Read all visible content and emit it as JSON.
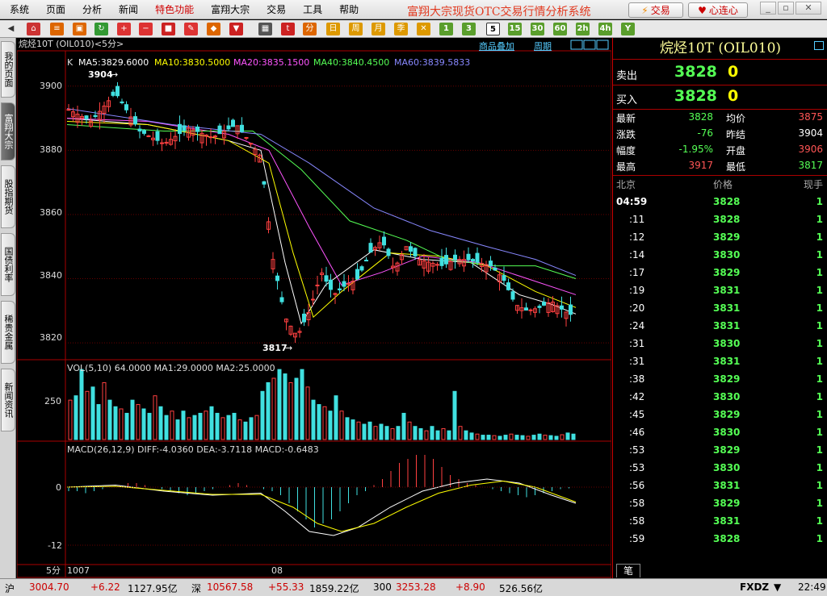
{
  "menu": {
    "items": [
      "系统",
      "页面",
      "分析",
      "新闻",
      "特色功能",
      "富翔大宗",
      "交易",
      "工具",
      "帮助"
    ],
    "app_title": "富翔大宗现货OTC交易行情分析系统",
    "trade_button": "交易",
    "connect_button": "心连心"
  },
  "toolbar": {
    "periods": [
      "1",
      "3",
      "5",
      "15",
      "30",
      "60",
      "2h",
      "4h",
      "Y"
    ],
    "active_period": "5"
  },
  "left_tabs": [
    "我的页面",
    "富翔大宗",
    "股指期货",
    "国债利率",
    "稀贵金属",
    "新闻资讯"
  ],
  "chart": {
    "header_title": "烷烃10T (OIL010)<5分>",
    "link_overlay": "商品叠加",
    "link_period": "周期",
    "ma_label_k": "K",
    "ma_labels": [
      {
        "text": "MA5:3829.6000",
        "color": "#ffffff"
      },
      {
        "text": "MA10:3830.5000",
        "color": "#ffff00"
      },
      {
        "text": "MA20:3835.1500",
        "color": "#ff55ff"
      },
      {
        "text": "MA40:3840.4500",
        "color": "#55ff55"
      },
      {
        "text": "MA60:3839.5833",
        "color": "#8888ff"
      }
    ],
    "price_ticks": [
      "3900",
      "3880",
      "3860",
      "3840",
      "3820"
    ],
    "high_marker": "3904",
    "low_marker": "3817",
    "vol_label": "VOL(5,10) 64.0000 MA1:29.0000 MA2:25.0000",
    "vol_tick": "250",
    "macd_label": "MACD(26,12,9) DIFF:-4.0360 DEA:-3.7118 MACD:-0.6483",
    "macd_ticks": [
      "0",
      "-12"
    ],
    "period_label": "5分",
    "date_labels": [
      "1007",
      "08"
    ]
  },
  "chart_data": {
    "type": "candlestick",
    "ylim": [
      3815,
      3910
    ],
    "trend_points": [
      [
        0,
        3893
      ],
      [
        30,
        3889
      ],
      [
        60,
        3898
      ],
      [
        90,
        3886
      ],
      [
        120,
        3882
      ],
      [
        150,
        3887
      ],
      [
        180,
        3884
      ],
      [
        210,
        3888
      ],
      [
        240,
        3878
      ],
      [
        255,
        3846
      ],
      [
        270,
        3828
      ],
      [
        285,
        3822
      ],
      [
        300,
        3830
      ],
      [
        315,
        3842
      ],
      [
        330,
        3835
      ],
      [
        345,
        3838
      ],
      [
        360,
        3840
      ],
      [
        375,
        3848
      ],
      [
        390,
        3852
      ],
      [
        405,
        3843
      ],
      [
        420,
        3850
      ],
      [
        435,
        3846
      ],
      [
        450,
        3845
      ],
      [
        465,
        3844
      ],
      [
        480,
        3846
      ],
      [
        495,
        3846
      ],
      [
        510,
        3845
      ],
      [
        525,
        3844
      ],
      [
        540,
        3840
      ],
      [
        555,
        3832
      ],
      [
        570,
        3830
      ],
      [
        585,
        3831
      ],
      [
        600,
        3833
      ],
      [
        615,
        3830
      ],
      [
        630,
        3828
      ]
    ],
    "ma_series": [
      {
        "name": "MA5",
        "color": "#ffffff",
        "points": [
          [
            0,
            3890
          ],
          [
            100,
            3888
          ],
          [
            200,
            3883
          ],
          [
            240,
            3880
          ],
          [
            270,
            3845
          ],
          [
            290,
            3826
          ],
          [
            320,
            3838
          ],
          [
            380,
            3849
          ],
          [
            440,
            3846
          ],
          [
            500,
            3845
          ],
          [
            560,
            3835
          ],
          [
            600,
            3832
          ],
          [
            630,
            3829
          ]
        ]
      },
      {
        "name": "MA10",
        "color": "#ffff00",
        "points": [
          [
            0,
            3889
          ],
          [
            100,
            3888
          ],
          [
            200,
            3883
          ],
          [
            250,
            3876
          ],
          [
            280,
            3848
          ],
          [
            305,
            3828
          ],
          [
            340,
            3836
          ],
          [
            400,
            3848
          ],
          [
            460,
            3847
          ],
          [
            520,
            3844
          ],
          [
            580,
            3836
          ],
          [
            630,
            3831
          ]
        ]
      },
      {
        "name": "MA20",
        "color": "#ff55ff",
        "points": [
          [
            0,
            3890
          ],
          [
            100,
            3889
          ],
          [
            200,
            3885
          ],
          [
            250,
            3880
          ],
          [
            300,
            3856
          ],
          [
            340,
            3838
          ],
          [
            390,
            3842
          ],
          [
            440,
            3847
          ],
          [
            510,
            3845
          ],
          [
            570,
            3840
          ],
          [
            630,
            3835
          ]
        ]
      },
      {
        "name": "MA40",
        "color": "#55ff55",
        "points": [
          [
            0,
            3888
          ],
          [
            120,
            3886
          ],
          [
            230,
            3886
          ],
          [
            290,
            3874
          ],
          [
            350,
            3858
          ],
          [
            420,
            3852
          ],
          [
            470,
            3846
          ],
          [
            530,
            3844
          ],
          [
            580,
            3844
          ],
          [
            630,
            3840
          ]
        ]
      },
      {
        "name": "MA60",
        "color": "#8888ff",
        "points": [
          [
            0,
            3893
          ],
          [
            130,
            3888
          ],
          [
            240,
            3885
          ],
          [
            300,
            3876
          ],
          [
            380,
            3862
          ],
          [
            450,
            3855
          ],
          [
            520,
            3850
          ],
          [
            580,
            3846
          ],
          [
            630,
            3841
          ]
        ]
      }
    ],
    "volume": [
      180,
      200,
      320,
      220,
      240,
      160,
      260,
      180,
      150,
      140,
      120,
      180,
      160,
      140,
      120,
      200,
      150,
      110,
      130,
      90,
      130,
      100,
      110,
      120,
      130,
      150,
      120,
      100,
      110,
      120,
      90,
      80,
      100,
      110,
      220,
      260,
      280,
      320,
      300,
      260,
      280,
      320,
      240,
      180,
      160,
      150,
      130,
      200,
      130,
      100,
      90,
      80,
      70,
      80,
      60,
      70,
      60,
      50,
      60,
      120,
      80,
      60,
      50,
      40,
      60,
      40,
      50,
      40,
      220,
      60,
      40,
      30,
      25,
      20,
      20,
      18,
      15,
      20,
      25,
      20,
      18,
      15,
      20,
      25,
      20,
      18,
      15,
      22,
      30,
      25
    ],
    "macd_bars": [
      -1,
      -1,
      -1.5,
      -1,
      -0.5,
      0,
      0.5,
      1,
      1,
      0.5,
      0,
      -0.5,
      -1,
      -1.5,
      -2,
      -1.5,
      -1,
      -0.5,
      0,
      0.5,
      1,
      0.5,
      0,
      -0.5,
      -1,
      -2,
      -4,
      -6,
      -8,
      -10,
      -9,
      -8,
      -6,
      -4,
      -2,
      -1,
      0.5,
      2,
      4,
      6,
      7,
      8,
      8,
      7,
      5,
      3,
      2,
      1,
      0.5,
      0,
      -0.5,
      -1,
      -1.5,
      -2,
      -2.5,
      -2,
      -1.5,
      -1,
      -0.5,
      -0.3
    ],
    "diff_line": [
      [
        0,
        0
      ],
      [
        60,
        0.5
      ],
      [
        120,
        -1
      ],
      [
        180,
        -2
      ],
      [
        240,
        -1.5
      ],
      [
        270,
        -6
      ],
      [
        300,
        -11
      ],
      [
        330,
        -12
      ],
      [
        360,
        -10
      ],
      [
        400,
        -5
      ],
      [
        440,
        -1
      ],
      [
        480,
        1
      ],
      [
        520,
        2
      ],
      [
        560,
        1
      ],
      [
        600,
        -2
      ],
      [
        630,
        -4
      ]
    ],
    "dea_line": [
      [
        0,
        0
      ],
      [
        60,
        0.2
      ],
      [
        120,
        -0.8
      ],
      [
        180,
        -1.8
      ],
      [
        240,
        -1.8
      ],
      [
        280,
        -5
      ],
      [
        310,
        -9
      ],
      [
        340,
        -11
      ],
      [
        380,
        -9
      ],
      [
        420,
        -5
      ],
      [
        460,
        -1.5
      ],
      [
        500,
        0.5
      ],
      [
        540,
        1.5
      ],
      [
        580,
        0
      ],
      [
        630,
        -3.7
      ]
    ]
  },
  "quote": {
    "title": "烷烃10T (OIL010)",
    "sell_label": "卖出",
    "sell_price": "3828",
    "sell_vol": "0",
    "buy_label": "买入",
    "buy_price": "3828",
    "buy_vol": "0",
    "fields": [
      {
        "l1": "最新",
        "v1": "3828",
        "c1": "#55ff55",
        "l2": "均价",
        "v2": "3875",
        "c2": "#ff5555"
      },
      {
        "l1": "涨跌",
        "v1": "-76",
        "c1": "#55ff55",
        "l2": "昨结",
        "v2": "3904",
        "c2": "#ffffff"
      },
      {
        "l1": "幅度",
        "v1": "-1.95%",
        "c1": "#55ff55",
        "l2": "开盘",
        "v2": "3906",
        "c2": "#ff5555"
      },
      {
        "l1": "最高",
        "v1": "3917",
        "c1": "#ff5555",
        "l2": "最低",
        "v2": "3817",
        "c2": "#55ff55"
      }
    ],
    "ticks_header": [
      "北京",
      "价格",
      "现手"
    ],
    "ticks": [
      {
        "time": "04:59",
        "price": "3828",
        "vol": "1",
        "c": "#55ff55"
      },
      {
        "time": ":11",
        "price": "3828",
        "vol": "1",
        "c": "#55ff55"
      },
      {
        "time": ":12",
        "price": "3829",
        "vol": "1",
        "c": "#55ff55"
      },
      {
        "time": ":14",
        "price": "3830",
        "vol": "1",
        "c": "#55ff55"
      },
      {
        "time": ":17",
        "price": "3829",
        "vol": "1",
        "c": "#55ff55"
      },
      {
        "time": ":19",
        "price": "3831",
        "vol": "1",
        "c": "#55ff55"
      },
      {
        "time": ":20",
        "price": "3831",
        "vol": "1",
        "c": "#55ff55"
      },
      {
        "time": ":24",
        "price": "3831",
        "vol": "1",
        "c": "#55ff55"
      },
      {
        "time": ":31",
        "price": "3830",
        "vol": "1",
        "c": "#55ff55"
      },
      {
        "time": ":31",
        "price": "3831",
        "vol": "1",
        "c": "#55ff55"
      },
      {
        "time": ":38",
        "price": "3829",
        "vol": "1",
        "c": "#55ff55"
      },
      {
        "time": ":42",
        "price": "3830",
        "vol": "1",
        "c": "#55ff55"
      },
      {
        "time": ":45",
        "price": "3829",
        "vol": "1",
        "c": "#55ff55"
      },
      {
        "time": ":46",
        "price": "3830",
        "vol": "1",
        "c": "#55ff55"
      },
      {
        "time": ":53",
        "price": "3829",
        "vol": "1",
        "c": "#55ff55"
      },
      {
        "time": ":53",
        "price": "3830",
        "vol": "1",
        "c": "#55ff55"
      },
      {
        "time": ":56",
        "price": "3831",
        "vol": "1",
        "c": "#55ff55"
      },
      {
        "time": ":58",
        "price": "3829",
        "vol": "1",
        "c": "#55ff55"
      },
      {
        "time": ":58",
        "price": "3831",
        "vol": "1",
        "c": "#55ff55"
      },
      {
        "time": ":59",
        "price": "3828",
        "vol": "1",
        "c": "#55ff55"
      }
    ],
    "bottom_tab": "笔"
  },
  "status": {
    "sh_label": "沪",
    "sh_price": "3004.70",
    "sh_change": "+6.22",
    "sh_amount": "1127.95亿",
    "sz_label": "深",
    "sz_price": "10567.58",
    "sz_change": "+55.33",
    "sz_amount": "1859.22亿",
    "i300_label": "300",
    "i300_price": "3253.28",
    "i300_change": "+8.90",
    "i300_amount": "526.56亿",
    "brand": "FXDZ",
    "time": "22:49"
  }
}
